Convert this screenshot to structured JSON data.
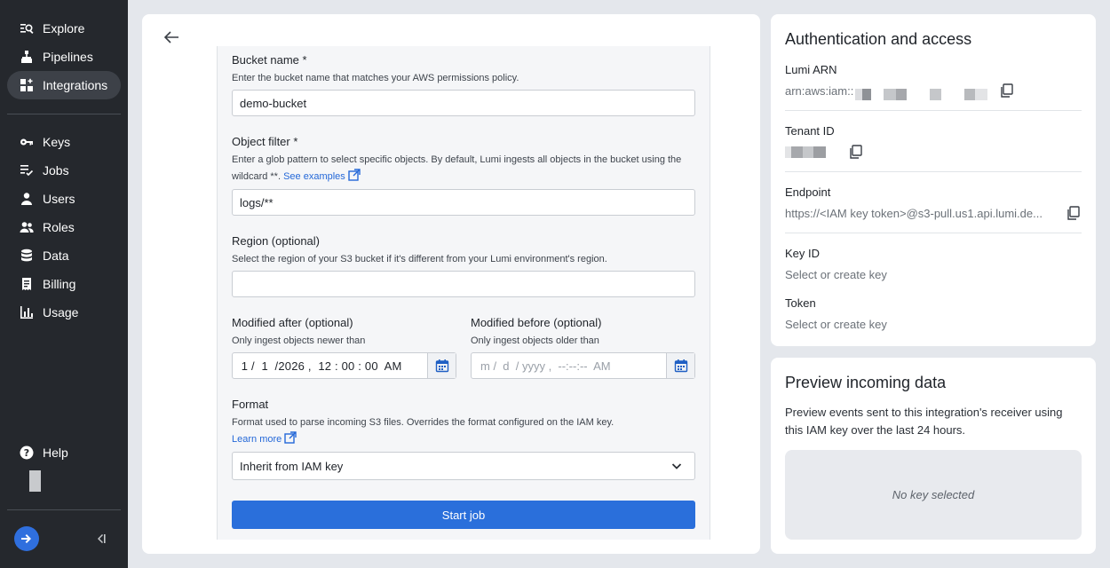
{
  "sidebar": {
    "items": [
      {
        "label": "Explore",
        "icon": "explore-icon"
      },
      {
        "label": "Pipelines",
        "icon": "pipelines-icon"
      },
      {
        "label": "Integrations",
        "icon": "integrations-icon",
        "active": true
      },
      {
        "label": "Keys",
        "icon": "key-icon"
      },
      {
        "label": "Jobs",
        "icon": "jobs-icon"
      },
      {
        "label": "Users",
        "icon": "user-icon"
      },
      {
        "label": "Roles",
        "icon": "roles-icon"
      },
      {
        "label": "Data",
        "icon": "database-icon"
      },
      {
        "label": "Billing",
        "icon": "billing-icon"
      },
      {
        "label": "Usage",
        "icon": "usage-icon"
      }
    ],
    "help_label": "Help"
  },
  "form": {
    "bucket": {
      "label": "Bucket name *",
      "help": "Enter the bucket name that matches your AWS permissions policy.",
      "value": "demo-bucket"
    },
    "object_filter": {
      "label": "Object filter *",
      "help": "Enter a glob pattern to select specific objects. By default, Lumi ingests all objects in the bucket using the wildcard **.",
      "link": "See examples",
      "value": "logs/**"
    },
    "region": {
      "label": "Region (optional)",
      "help": "Select the region of your S3 bucket if it's different from your Lumi environment's region.",
      "value": ""
    },
    "modified_after": {
      "label": "Modified after (optional)",
      "help": "Only ingest objects newer than",
      "value": " 1 /  1  /2026 ,  12 : 00 : 00  AM"
    },
    "modified_before": {
      "label": "Modified before (optional)",
      "help": "Only ingest objects older than",
      "placeholder": "m /  d  / yyyy ,  --:--:--  AM"
    },
    "format": {
      "label": "Format",
      "help": "Format used to parse incoming S3 files. Overrides the format configured on the IAM key.",
      "link": "Learn more",
      "value": "Inherit from IAM key"
    },
    "submit_label": "Start job"
  },
  "auth": {
    "title": "Authentication and access",
    "arn_label": "Lumi ARN",
    "arn_value": "arn:aws:iam::",
    "tenant_label": "Tenant ID",
    "endpoint_label": "Endpoint",
    "endpoint_value": "https://<IAM key token>@s3-pull.us1.api.lumi.de...",
    "key_label": "Key ID",
    "key_value": "Select or create key",
    "token_label": "Token",
    "token_value": "Select or create key"
  },
  "preview": {
    "title": "Preview incoming data",
    "description": "Preview events sent to this integration's receiver using this IAM key over the last 24 hours.",
    "empty": "No key selected"
  },
  "colors": {
    "sidebar_bg": "#25282d",
    "accent": "#2a6fdb",
    "page_bg": "#e4e7ec"
  }
}
